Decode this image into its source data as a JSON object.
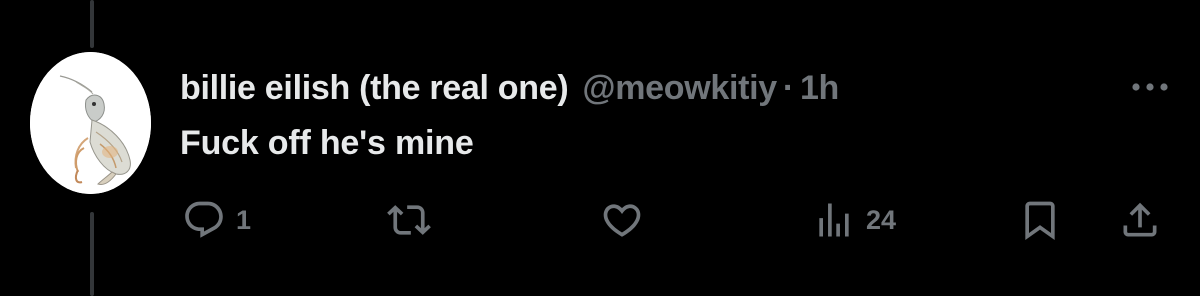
{
  "post": {
    "display_name": "billie eilish (the real one)",
    "handle": "@meowkitiy",
    "separator": "·",
    "time": "1h",
    "text": "Fuck off he's mine"
  },
  "actions": {
    "reply_count": "1",
    "retweet_count": "",
    "like_count": "",
    "views_count": "24"
  },
  "icons": {
    "more": "more-horizontal-icon",
    "reply": "reply-icon",
    "retweet": "retweet-icon",
    "like": "heart-icon",
    "views": "views-icon",
    "bookmark": "bookmark-icon",
    "share": "share-icon"
  },
  "colors": {
    "background": "#000000",
    "primary_text": "#e7e9ea",
    "secondary_text": "#71767b",
    "thread_line": "#333639"
  }
}
